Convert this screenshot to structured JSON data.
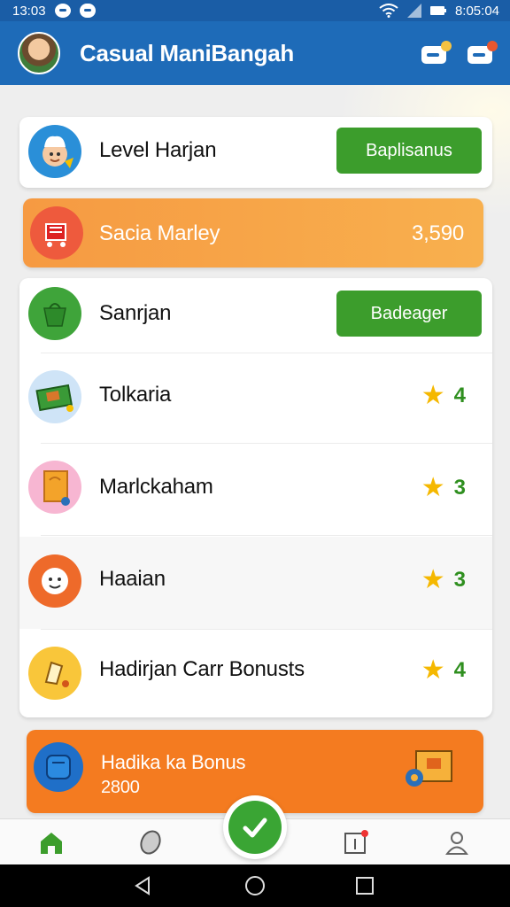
{
  "status_bar": {
    "left_time": "13:03",
    "right_time": "8:05:04"
  },
  "app": {
    "title": "Casual ManiBangah"
  },
  "cards": {
    "level": {
      "label": "Level Harjan",
      "button": "Baplisanus"
    },
    "promo": {
      "label": "Sacia Marley",
      "value": "3,590"
    },
    "section": {
      "label": "Sanrjan",
      "button": "Badeager"
    }
  },
  "items": [
    {
      "label": "Tolkaria",
      "rating": "4"
    },
    {
      "label": "Marlckaham",
      "rating": "3"
    },
    {
      "label": "Haaian",
      "rating": "3"
    },
    {
      "label": "Hadirjan Carr Bonusts",
      "rating": "4"
    }
  ],
  "bonus": {
    "title": "Hadika ka Bonus",
    "amount": "2800"
  },
  "colors": {
    "appbar": "#1e6bb8",
    "green": "#3c9d2c",
    "orange": "#f47b20",
    "promo": "#f7a744",
    "star": "#f5b800"
  }
}
